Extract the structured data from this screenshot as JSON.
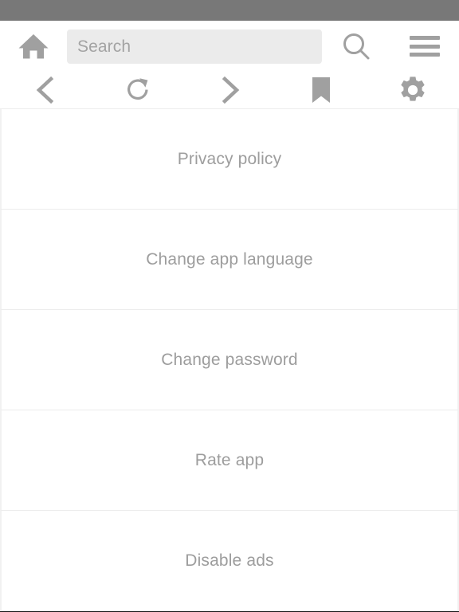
{
  "colors": {
    "status_bar": "#787878",
    "icon": "#a0a0a0",
    "search_field_bg": "#ebebeb",
    "placeholder_text": "#a3a3a3",
    "list_text": "#9d9d9d",
    "divider": "#ececec",
    "page_bg": "#ffffff"
  },
  "status_bar": {
    "label": ""
  },
  "top_bar": {
    "home_icon": "home-icon",
    "search": {
      "placeholder": "Search",
      "value": ""
    },
    "search_icon": "search-icon",
    "menu_icon": "hamburger-menu-icon"
  },
  "toolbar": {
    "buttons": [
      {
        "name": "back-button",
        "icon": "chevron-left-icon"
      },
      {
        "name": "reload-button",
        "icon": "reload-icon"
      },
      {
        "name": "forward-button",
        "icon": "chevron-right-icon"
      },
      {
        "name": "bookmark-button",
        "icon": "bookmark-icon"
      },
      {
        "name": "settings-button",
        "icon": "gear-icon"
      }
    ]
  },
  "list": {
    "items": [
      {
        "label": "Privacy policy"
      },
      {
        "label": "Change app language"
      },
      {
        "label": "Change password"
      },
      {
        "label": "Rate app"
      },
      {
        "label": "Disable ads"
      }
    ]
  }
}
